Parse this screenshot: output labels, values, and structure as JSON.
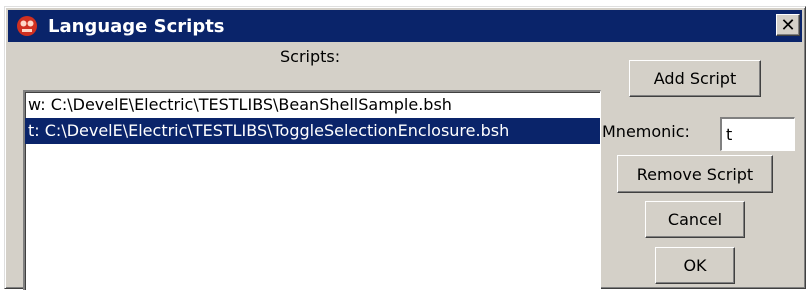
{
  "window": {
    "title": "Language Scripts",
    "close_glyph": "✕",
    "app_icon": "electric-app-icon"
  },
  "scripts": {
    "label": "Scripts:",
    "items": [
      {
        "text": "w: C:\\DevelE\\Electric\\TESTLIBS\\BeanShellSample.bsh",
        "selected": false
      },
      {
        "text": "t: C:\\DevelE\\Electric\\TESTLIBS\\ToggleSelectionEnclosure.bsh",
        "selected": true
      }
    ]
  },
  "buttons": {
    "add_script": "Add Script",
    "remove_script": "Remove Script",
    "cancel": "Cancel",
    "ok": "OK"
  },
  "mnemonic": {
    "label": "Mnemonic:",
    "value": "t"
  },
  "colors": {
    "title_bar": "#0a246a",
    "selection": "#0a246a",
    "dialog_face": "#d4d0c8"
  }
}
